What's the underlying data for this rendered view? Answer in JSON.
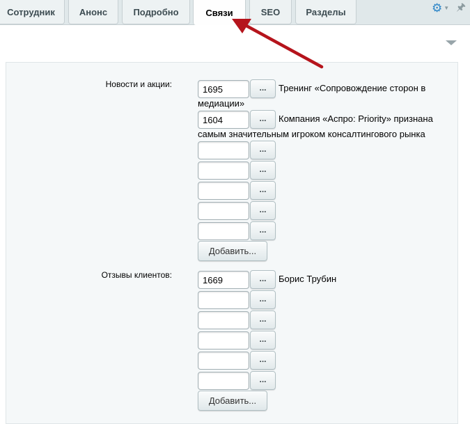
{
  "tabs": [
    {
      "label": "Сотрудник",
      "active": false
    },
    {
      "label": "Анонс",
      "active": false
    },
    {
      "label": "Подробно",
      "active": false
    },
    {
      "label": "Связи",
      "active": true
    },
    {
      "label": "SEO",
      "active": false
    },
    {
      "label": "Разделы",
      "active": false
    }
  ],
  "toolbar": {
    "settings_icon": "gear-icon",
    "pin_icon": "pin-icon"
  },
  "colors": {
    "accent_gear": "#2e86c8",
    "annotation_arrow": "#b5141c",
    "tab_bar_bg": "#e0e8ea",
    "panel_bg": "#f5f8f9"
  },
  "sections": [
    {
      "label": "Новости и акции:",
      "rows": [
        {
          "value": "1695",
          "linked_text": "Тренинг «Сопровождение сторон в медиации»",
          "button": "..."
        },
        {
          "value": "1604",
          "linked_text": "Компания «Аспро: Priority» признана самым значительным игроком консалтингового рынка",
          "button": "..."
        },
        {
          "value": "",
          "linked_text": "",
          "button": "..."
        },
        {
          "value": "",
          "linked_text": "",
          "button": "..."
        },
        {
          "value": "",
          "linked_text": "",
          "button": "..."
        },
        {
          "value": "",
          "linked_text": "",
          "button": "..."
        },
        {
          "value": "",
          "linked_text": "",
          "button": "..."
        }
      ],
      "add_label": "Добавить..."
    },
    {
      "label": "Отзывы клиентов:",
      "rows": [
        {
          "value": "1669",
          "linked_text": "Борис Трубин",
          "button": "..."
        },
        {
          "value": "",
          "linked_text": "",
          "button": "..."
        },
        {
          "value": "",
          "linked_text": "",
          "button": "..."
        },
        {
          "value": "",
          "linked_text": "",
          "button": "..."
        },
        {
          "value": "",
          "linked_text": "",
          "button": "..."
        },
        {
          "value": "",
          "linked_text": "",
          "button": "..."
        }
      ],
      "add_label": "Добавить..."
    }
  ]
}
